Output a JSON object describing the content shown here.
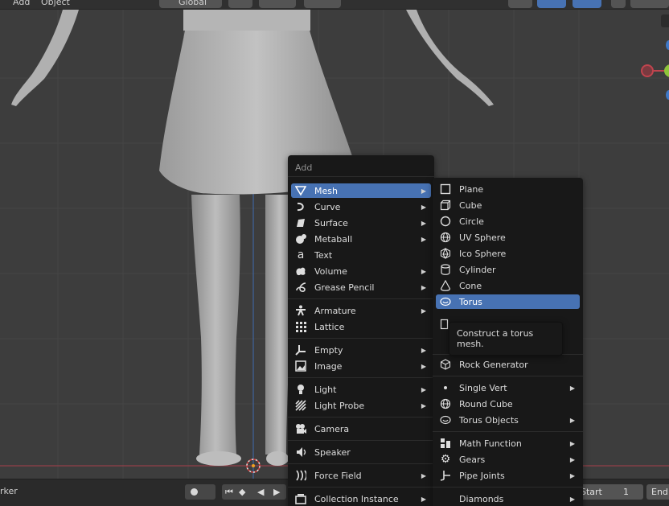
{
  "header": {
    "menu_add": "Add",
    "menu_object": "Object",
    "orientation_value": "Global"
  },
  "timeline": {
    "marker_label": "rker",
    "start_label": "Start",
    "start_value": "1",
    "end_label": "End"
  },
  "add_menu": {
    "title": "Add",
    "items": [
      {
        "label": "Mesh",
        "icon": "mesh-icon"
      },
      {
        "label": "Curve",
        "icon": "curve-icon"
      },
      {
        "label": "Surface",
        "icon": "surface-icon"
      },
      {
        "label": "Metaball",
        "icon": "metaball-icon"
      },
      {
        "label": "Text",
        "icon": "text-icon"
      },
      {
        "label": "Volume",
        "icon": "volume-icon"
      },
      {
        "label": "Grease Pencil",
        "icon": "grease-pencil-icon"
      },
      {
        "label": "Armature",
        "icon": "armature-icon"
      },
      {
        "label": "Lattice",
        "icon": "lattice-icon"
      },
      {
        "label": "Empty",
        "icon": "empty-icon"
      },
      {
        "label": "Image",
        "icon": "image-icon"
      },
      {
        "label": "Light",
        "icon": "light-icon"
      },
      {
        "label": "Light Probe",
        "icon": "light-probe-icon"
      },
      {
        "label": "Camera",
        "icon": "camera-icon"
      },
      {
        "label": "Speaker",
        "icon": "speaker-icon"
      },
      {
        "label": "Force Field",
        "icon": "force-field-icon"
      },
      {
        "label": "Collection Instance",
        "icon": "collection-icon"
      }
    ]
  },
  "mesh_menu": {
    "items": [
      {
        "label": "Plane",
        "icon": "plane-icon"
      },
      {
        "label": "Cube",
        "icon": "cube-icon"
      },
      {
        "label": "Circle",
        "icon": "circle-icon"
      },
      {
        "label": "UV Sphere",
        "icon": "uv-sphere-icon"
      },
      {
        "label": "Ico Sphere",
        "icon": "ico-sphere-icon"
      },
      {
        "label": "Cylinder",
        "icon": "cylinder-icon"
      },
      {
        "label": "Cone",
        "icon": "cone-icon"
      },
      {
        "label": "Torus",
        "icon": "torus-icon"
      },
      {
        "label": "Rock Generator",
        "icon": "rock-generator-icon"
      },
      {
        "label": "Single Vert",
        "icon": "single-vert-icon"
      },
      {
        "label": "Round Cube",
        "icon": "round-cube-icon"
      },
      {
        "label": "Torus Objects",
        "icon": "torus-objects-icon"
      },
      {
        "label": "Math Function",
        "icon": "math-function-icon"
      },
      {
        "label": "Gears",
        "icon": "gears-icon"
      },
      {
        "label": "Pipe Joints",
        "icon": "pipe-joints-icon"
      },
      {
        "label": "Diamonds",
        "icon": "diamonds-icon"
      }
    ]
  },
  "tooltip": {
    "text": "Construct a torus mesh."
  },
  "colors": {
    "highlight": "#4772b3",
    "menu_bg": "#181818",
    "viewport_bg": "#3d3d3d",
    "x_axis": "#a8404a"
  }
}
